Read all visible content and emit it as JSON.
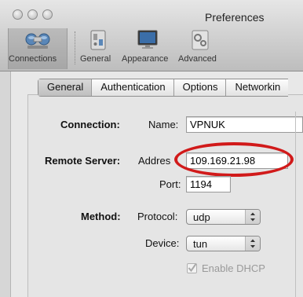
{
  "window": {
    "title": "Preferences"
  },
  "toolbar": {
    "items": [
      {
        "label": "Connections",
        "icon": "connections-icon",
        "selected": true
      },
      {
        "label": "General",
        "icon": "general-switch-icon",
        "selected": false
      },
      {
        "label": "Appearance",
        "icon": "monitor-icon",
        "selected": false
      },
      {
        "label": "Advanced",
        "icon": "advanced-gears-icon",
        "selected": false
      }
    ]
  },
  "tabs": [
    {
      "label": "General",
      "selected": true
    },
    {
      "label": "Authentication",
      "selected": false
    },
    {
      "label": "Options",
      "selected": false
    },
    {
      "label": "Networkin",
      "selected": false
    }
  ],
  "form": {
    "connection_section": "Connection:",
    "name_label": "Name:",
    "name_value": "VPNUK",
    "remote_section": "Remote Server:",
    "address_label": "Addres",
    "address_value": "109.169.21.98",
    "port_label": "Port:",
    "port_value": "1194",
    "method_section": "Method:",
    "protocol_label": "Protocol:",
    "protocol_value": "udp",
    "device_label": "Device:",
    "device_value": "tun",
    "dhcp_label": "Enable DHCP",
    "dhcp_checked": true
  },
  "colors": {
    "highlight_ring": "#d11a1a"
  }
}
